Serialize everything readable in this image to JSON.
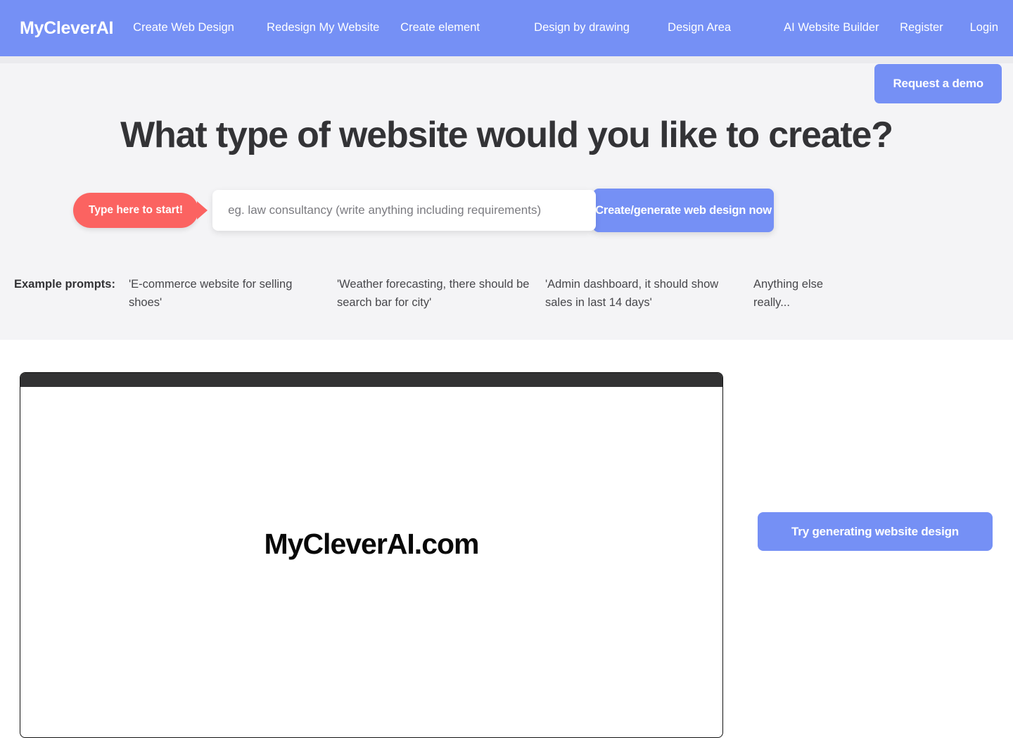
{
  "navbar": {
    "brand": "MyCleverAI",
    "links": [
      {
        "label": "Create Web Design"
      },
      {
        "label": "Redesign My Website"
      },
      {
        "label": "Create element"
      },
      {
        "label": "Design by drawing"
      },
      {
        "label": "Design Area"
      },
      {
        "label": "AI Website Builder"
      }
    ],
    "auth": [
      {
        "label": "Register"
      },
      {
        "label": "Login"
      }
    ],
    "background_color": "#7590F5"
  },
  "hero": {
    "demo_button_label": "Request a demo",
    "title": "What type of website would you like to create?",
    "badge_label": "Type here to start!",
    "badge_color": "#FB6361",
    "search_placeholder": "eg. law consultancy (write anything including requirements)",
    "search_value": "",
    "generate_button_label": "Create/generate web design now",
    "background_color": "#F4F4F6"
  },
  "example_prompts": {
    "label": "Example prompts:",
    "items": [
      "'E-commerce website for selling shoes'",
      "'Weather forecasting, there should be search bar for city'",
      "'Admin dashboard, it should show sales in last 14 days'",
      "Anything else really..."
    ]
  },
  "showcase": {
    "mock_title": "MyCleverAI.com",
    "try_button_label": "Try generating website design",
    "accent_color": "#7590F5"
  }
}
